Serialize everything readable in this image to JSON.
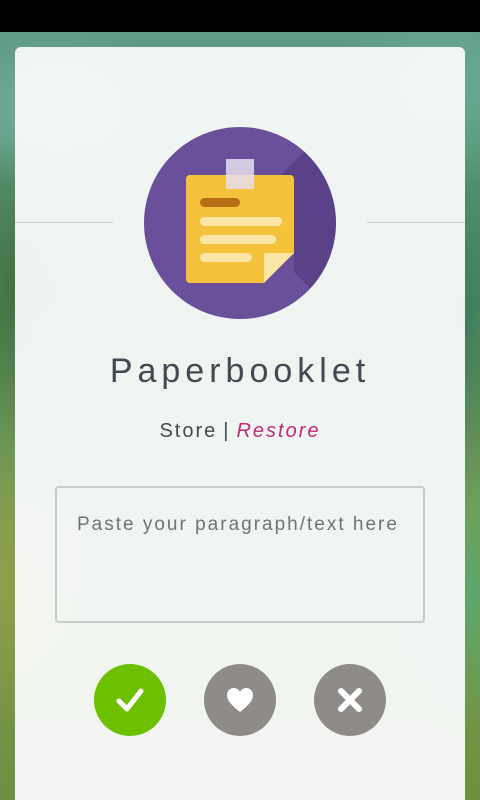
{
  "app": {
    "title": "Paperbooklet"
  },
  "nav": {
    "store_label": "Store",
    "separator": "|",
    "restore_label": "Restore"
  },
  "input": {
    "placeholder": "Paste your paragraph/text here",
    "value": ""
  },
  "actions": {
    "confirm_icon": "check-icon",
    "favorite_icon": "heart-icon",
    "close_icon": "close-icon"
  },
  "colors": {
    "logo_circle": "#6a4f9b",
    "note": "#f5c23c",
    "restore_link": "#c4267a",
    "confirm_button": "#6cc000",
    "secondary_button": "#8f8b88"
  }
}
